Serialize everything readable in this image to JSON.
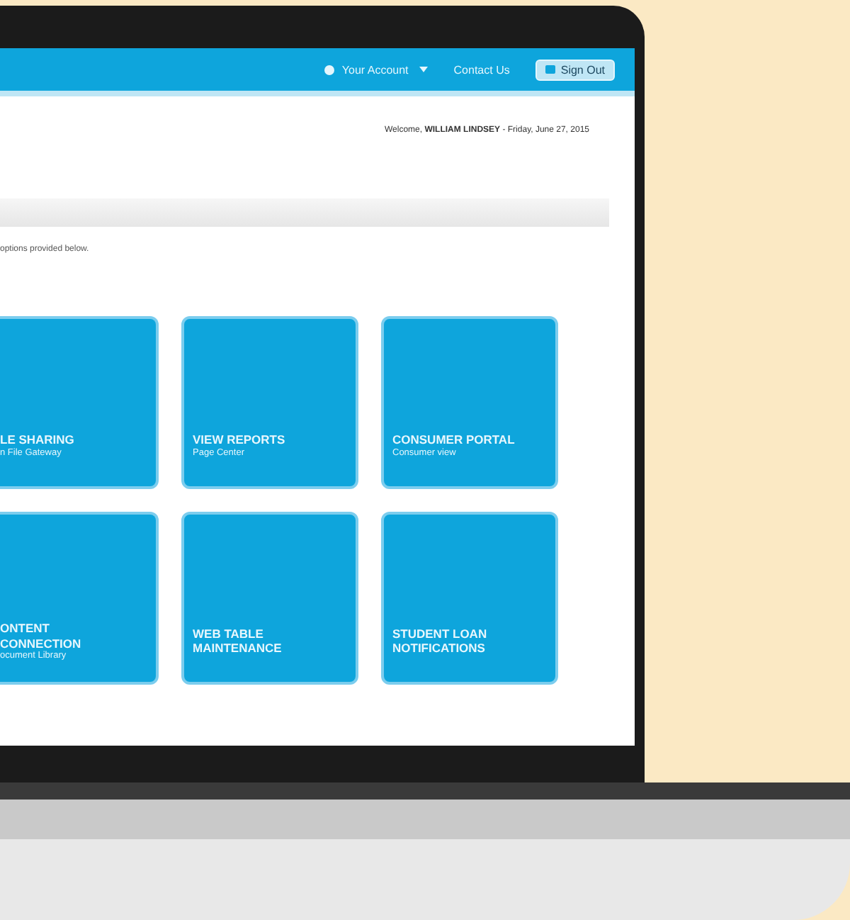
{
  "header": {
    "account_menu": "Your Account",
    "contact_link": "Contact Us",
    "sign_out_button": "Sign Out"
  },
  "welcome": {
    "greeting": "Welcome, ",
    "user": "WILLIAM LINDSEY",
    "date": " - Friday, June 27, 2015"
  },
  "instruction": "options provided below.",
  "tiles": [
    {
      "title": "LE SHARING",
      "subtitle": "n File Gateway"
    },
    {
      "title": "VIEW REPORTS",
      "subtitle": "Page Center"
    },
    {
      "title": "CONSUMER PORTAL",
      "subtitle": "Consumer view"
    },
    {
      "title": "ONTENT\nCONNECTION",
      "subtitle": "ocument Library"
    },
    {
      "title": "WEB TABLE\nMAINTENANCE"
    },
    {
      "title": "STUDENT LOAN\nNOTIFICATIONS"
    }
  ]
}
